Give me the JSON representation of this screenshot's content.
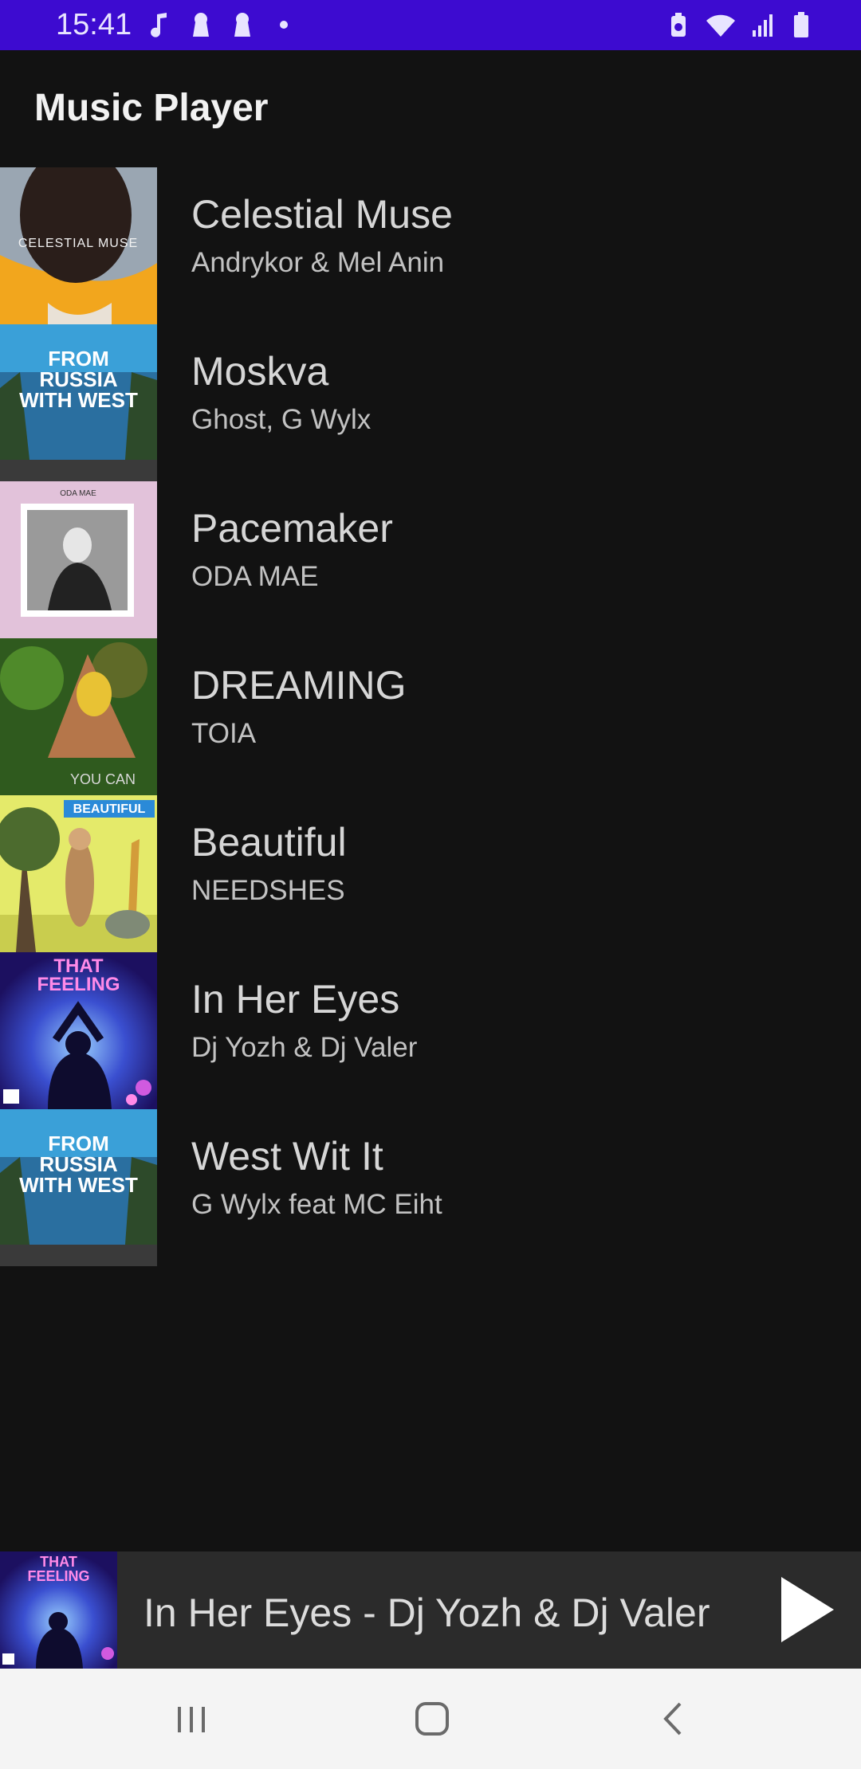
{
  "status_bar": {
    "time": "15:41",
    "left_icons": [
      "music-note-icon",
      "keyhole-icon",
      "keyhole-icon",
      "dot-icon"
    ],
    "right_icons": [
      "battery-saver-icon",
      "wifi-icon",
      "signal-icon",
      "battery-icon"
    ],
    "color": "#3d0bd0"
  },
  "app_bar": {
    "title": "Music Player"
  },
  "songs": [
    {
      "title": "Celestial Muse",
      "artist": "Andrykor & Mel Anin",
      "art_text": "CELESTIAL MUSE"
    },
    {
      "title": "Moskva",
      "artist": "Ghost, G Wylx",
      "art_text": "FROM RUSSIA WITH WEST"
    },
    {
      "title": "Pacemaker",
      "artist": "ODA MAE",
      "art_text": "ODA MAE"
    },
    {
      "title": "DREAMING",
      "artist": "TOIA",
      "art_text": "YOU CAN"
    },
    {
      "title": "Beautiful",
      "artist": "NEEDSHES",
      "art_text": "BEAUTIFUL"
    },
    {
      "title": "In Her Eyes",
      "artist": "Dj Yozh & Dj Valer",
      "art_text": "THAT FEELING"
    },
    {
      "title": "West Wit It",
      "artist": "G Wylx feat MC Eiht",
      "art_text": "FROM RUSSIA WITH WEST"
    }
  ],
  "mini_player": {
    "now_playing": "In Her Eyes - Dj Yozh & Dj Valer",
    "art_text": "THAT FEELING",
    "play_icon": "play-icon"
  },
  "nav_bar": {
    "icons": [
      "recent-apps-icon",
      "home-icon",
      "back-icon"
    ]
  }
}
